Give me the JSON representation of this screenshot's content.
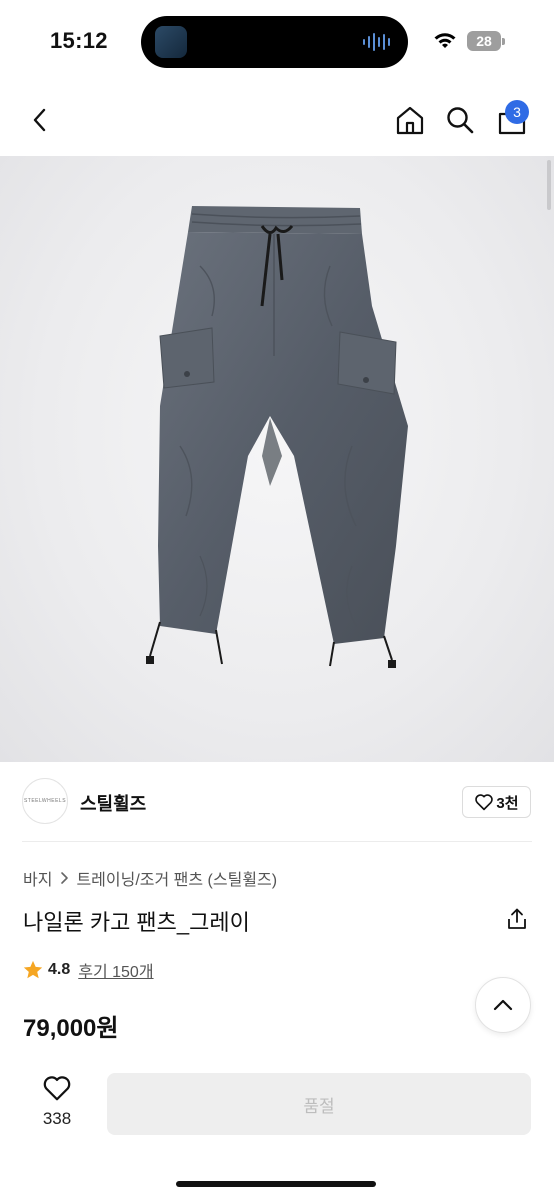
{
  "status_bar": {
    "time": "15:12",
    "battery": "28"
  },
  "nav": {
    "cart_count": "3",
    "icons": [
      "back-chevron-icon",
      "home-icon",
      "search-icon",
      "shopping-bag-icon"
    ]
  },
  "product_image": {
    "subject": "cargo-pants-photo"
  },
  "brand": {
    "logo_text": "STEELWHEELS",
    "name": "스틸휠즈",
    "likes": "3천"
  },
  "breadcrumb": {
    "category": "바지",
    "subcategory": "트레이닝/조거 팬츠 (스틸휠즈)"
  },
  "product": {
    "title": "나일론 카고 팬츠_그레이",
    "rating": "4.8",
    "reviews": "후기 150개",
    "price": "79,000원"
  },
  "bottom_bar": {
    "wish_count": "338",
    "buy_label": "품절"
  },
  "colors": {
    "badge": "#2f6be5",
    "star": "#f5a623",
    "pants": "#5c6470"
  }
}
